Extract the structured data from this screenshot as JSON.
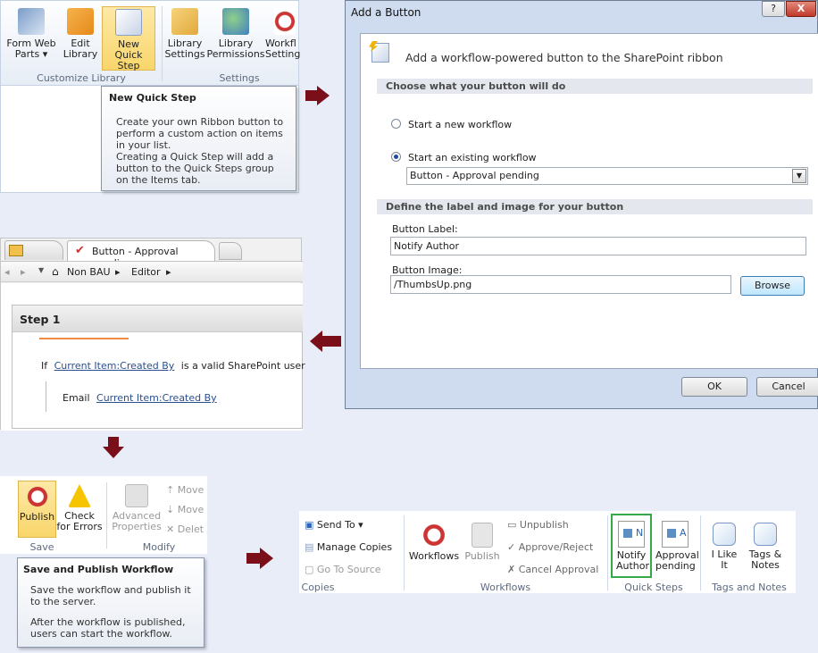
{
  "ribbon1": {
    "buttons": [
      {
        "label": "Form Web Parts ▾"
      },
      {
        "label": "Edit Library"
      },
      {
        "label": "New Quick Step"
      },
      {
        "label": "Library Settings"
      },
      {
        "label": "Library Permissions"
      },
      {
        "label": "Workfl Setting"
      }
    ],
    "groups": [
      "Customize Library",
      "Settings"
    ]
  },
  "tip1": {
    "title": "New Quick Step",
    "body1": "Create your own Ribbon button to perform a custom action on items in your list.",
    "body2": "Creating a Quick Step will add a button to the Quick Steps group on the Items tab."
  },
  "dialog": {
    "title": "Add a Button",
    "help": "?",
    "close": "X",
    "header": "Add a workflow-powered button to the SharePoint ribbon",
    "section1": "Choose what your button will do",
    "opt1": "Start a new workflow",
    "opt2": "Start an existing workflow",
    "select_value": "Button - Approval pending",
    "section2": "Define the label and image for your button",
    "label_caption": "Button Label:",
    "label_value": "Notify Author",
    "image_caption": "Button Image:",
    "image_value": "/ThumbsUp.png",
    "browse": "Browse",
    "ok": "OK",
    "cancel": "Cancel"
  },
  "designer": {
    "tab": "Button - Approval pending",
    "crumb1": "Non BAU",
    "crumb2": "Editor",
    "step": "Step 1",
    "if_word": "If",
    "cond_link": "Current Item:Created By",
    "cond_rest": "is a valid SharePoint user",
    "email_word": "Email",
    "email_link": "Current Item:Created By"
  },
  "ribbon2": {
    "publish": "Publish",
    "check": "Check for Errors",
    "advanced": "Advanced Properties",
    "move1": "Move",
    "move2": "Move",
    "delete": "Delet",
    "group_save": "Save",
    "group_modify": "Modify"
  },
  "tip2": {
    "title": "Save and Publish Workflow",
    "body1": "Save the workflow and publish it to the server.",
    "body2": "After the workflow is published, users can start the workflow."
  },
  "ribbon3": {
    "send_to": "Send To ▾",
    "manage_copies": "Manage Copies",
    "go_to_source": "Go To Source",
    "workflows": "Workflows",
    "publish": "Publish",
    "unpublish": "Unpublish",
    "approve_reject": "Approve/Reject",
    "cancel_approval": "Cancel Approval",
    "notify_author": "Notify Author",
    "approval_pending": "Approval pending",
    "i_like_it": "I Like It",
    "tags_notes": "Tags & Notes",
    "groups": [
      "Copies",
      "Workflows",
      "Quick Steps",
      "Tags and Notes"
    ],
    "qs_letter1": "N",
    "qs_letter2": "A"
  },
  "colors": {
    "arrow": "#7a0f1a",
    "highlight": "#f9d66b",
    "green_box": "#35a847"
  }
}
